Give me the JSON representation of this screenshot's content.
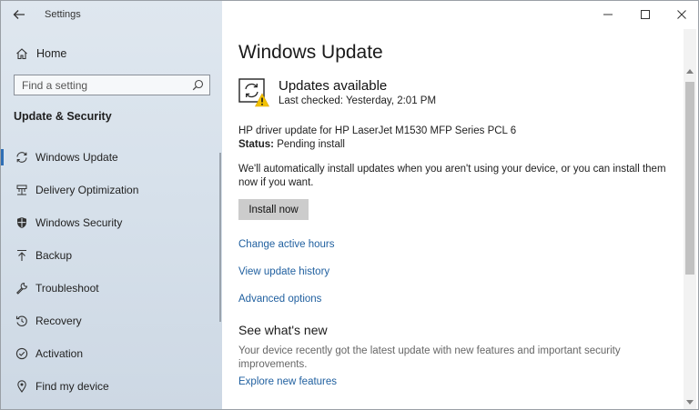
{
  "window": {
    "app_title": "Settings",
    "controls": [
      "minimize",
      "maximize",
      "close"
    ]
  },
  "sidebar": {
    "home_label": "Home",
    "search_placeholder": "Find a setting",
    "section_title": "Update & Security",
    "items": [
      {
        "label": "Windows Update",
        "icon": "sync-icon",
        "selected": true
      },
      {
        "label": "Delivery Optimization",
        "icon": "delivery-optimization-icon",
        "selected": false
      },
      {
        "label": "Windows Security",
        "icon": "shield-icon",
        "selected": false
      },
      {
        "label": "Backup",
        "icon": "backup-arrow-icon",
        "selected": false
      },
      {
        "label": "Troubleshoot",
        "icon": "wrench-icon",
        "selected": false
      },
      {
        "label": "Recovery",
        "icon": "recovery-icon",
        "selected": false
      },
      {
        "label": "Activation",
        "icon": "check-circle-icon",
        "selected": false
      },
      {
        "label": "Find my device",
        "icon": "find-device-icon",
        "selected": false
      }
    ]
  },
  "main": {
    "page_title": "Windows Update",
    "status": {
      "title": "Updates available",
      "last_checked": "Last checked: Yesterday, 2:01 PM",
      "icon": "update-warning-icon"
    },
    "update_name": "HP driver update for HP LaserJet M1530 MFP Series PCL 6",
    "status_key": "Status:",
    "status_value": "Pending install",
    "auto_install_text": "We'll automatically install updates when you aren't using your device, or you can install them now if you want.",
    "install_button": "Install now",
    "links": {
      "active_hours": "Change active hours",
      "history": "View update history",
      "advanced": "Advanced options"
    },
    "whats_new": {
      "title": "See what's new",
      "text": "Your device recently got the latest update with new features and important security improvements.",
      "link": "Explore new features"
    }
  },
  "colors": {
    "accent": "#2f6fb5",
    "link": "#1f5f9f",
    "warning": "#f2c200",
    "sidebar_bg": "#d9e2ec",
    "button_bg": "#cccccc"
  }
}
